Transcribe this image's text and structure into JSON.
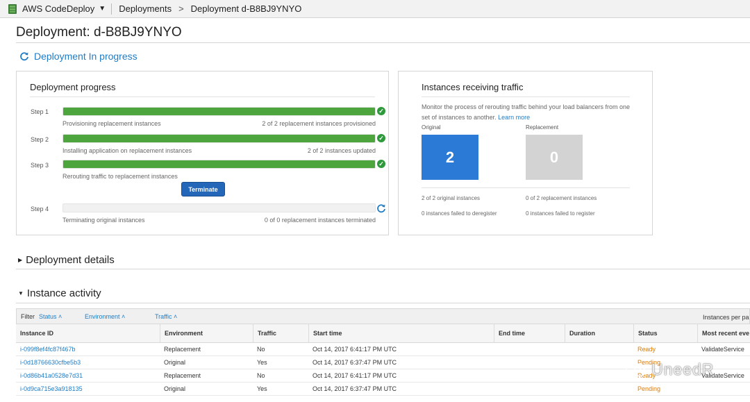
{
  "nav": {
    "service": "AWS CodeDeploy",
    "crumb1": "Deployments",
    "crumb_sep": ">",
    "crumb2": "Deployment d-B8BJ9YNYO"
  },
  "page": {
    "title": "Deployment: d-B8BJ9YNYO",
    "status": "Deployment In progress"
  },
  "progress": {
    "heading": "Deployment progress",
    "steps": [
      {
        "label": "Step 1",
        "progress": 1.0,
        "left": "Provisioning replacement instances",
        "right": "2 of 2 replacement instances provisioned",
        "state": "complete"
      },
      {
        "label": "Step 2",
        "progress": 1.0,
        "left": "Installing application on replacement instances",
        "right": "2 of 2 instances updated",
        "state": "complete"
      },
      {
        "label": "Step 3",
        "progress": 1.0,
        "left": "Rerouting traffic to replacement instances",
        "right": "",
        "state": "complete"
      },
      {
        "label": "Step 4",
        "progress": 0.0,
        "left": "Terminating original instances",
        "right": "0 of 0 replacement instances terminated",
        "state": "in-progress"
      }
    ],
    "terminate_label": "Terminate"
  },
  "traffic": {
    "heading": "Instances receiving traffic",
    "desc": "Monitor the process of rerouting traffic behind your load balancers from one set of instances to another.",
    "learn_more": "Learn more",
    "original_label": "Original",
    "replacement_label": "Replacement",
    "original_count": "2",
    "replacement_count": "0",
    "original_info1": "2 of 2 original instances",
    "original_info2": "0 instances failed to deregister",
    "replacement_info1": "0 of 2 replacement instances",
    "replacement_info2": "0 instances failed to register",
    "colors": {
      "original": "#2b7bd6",
      "replacement": "#d3d3d3"
    }
  },
  "sections": {
    "details": "Deployment details",
    "activity": "Instance activity"
  },
  "filter": {
    "label": "Filter",
    "status": "Status",
    "environment": "Environment",
    "traffic": "Traffic",
    "per_page": "Instances per pa"
  },
  "table": {
    "columns": [
      "Instance ID",
      "Environment",
      "Traffic",
      "Start time",
      "End time",
      "Duration",
      "Status",
      "Most recent eve"
    ],
    "rows": [
      {
        "id": "i-099f8ef4fc87f467b",
        "env": "Replacement",
        "traffic": "No",
        "start": "Oct 14, 2017 6:41:17 PM UTC",
        "end": "",
        "duration": "",
        "status": "Ready",
        "event": "ValidateService"
      },
      {
        "id": "i-0d18766630cfbe5b3",
        "env": "Original",
        "traffic": "Yes",
        "start": "Oct 14, 2017 6:37:47 PM UTC",
        "end": "",
        "duration": "",
        "status": "Pending",
        "event": ""
      },
      {
        "id": "i-0d86b41a0528e7d31",
        "env": "Replacement",
        "traffic": "No",
        "start": "Oct 14, 2017 6:41:17 PM UTC",
        "end": "",
        "duration": "",
        "status": "Ready",
        "event": "ValidateService"
      },
      {
        "id": "i-0d9ca715e3a918135",
        "env": "Original",
        "traffic": "Yes",
        "start": "Oct 14, 2017 6:37:47 PM UTC",
        "end": "",
        "duration": "",
        "status": "Pending",
        "event": ""
      }
    ]
  },
  "watermark": "UneedR"
}
